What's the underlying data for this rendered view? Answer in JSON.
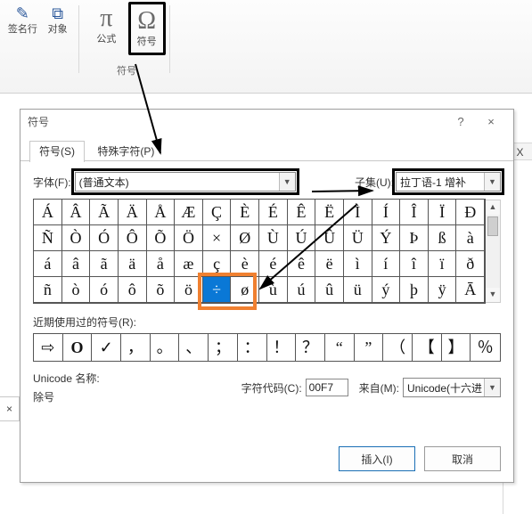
{
  "ribbon": {
    "group1": {
      "sign_line": "签名行",
      "object": "对象",
      "sign_icon": "✎",
      "object_icon": "⧉"
    },
    "group2": {
      "equation": "公式",
      "equation_icon": "π",
      "symbol": "符号",
      "symbol_icon": "Ω",
      "group_label": "符号"
    }
  },
  "sheet": {
    "col_letter": "X"
  },
  "dismiss": {
    "x": "×"
  },
  "dialog": {
    "title": "符号",
    "help_icon": "?",
    "close_icon": "×",
    "tabs": {
      "symbols": "符号(S)",
      "special": "特殊字符(P)"
    },
    "font_label": "字体(F):",
    "font_value": "(普通文本)",
    "subset_label": "子集(U):",
    "subset_value": "拉丁语-1 增补",
    "chargrid": {
      "row1": [
        "Á",
        "Â",
        "Ã",
        "Ä",
        "Å",
        "Æ",
        "Ç",
        "È",
        "É",
        "Ê",
        "Ë",
        "Ì",
        "Í",
        "Î",
        "Ï",
        "Ð"
      ],
      "row2": [
        "Ñ",
        "Ò",
        "Ó",
        "Ô",
        "Õ",
        "Ö",
        "×",
        "Ø",
        "Ù",
        "Ú",
        "Û",
        "Ü",
        "Ý",
        "Þ",
        "ß",
        "à"
      ],
      "row3": [
        "á",
        "â",
        "ã",
        "ä",
        "å",
        "æ",
        "ç",
        "è",
        "é",
        "ê",
        "ë",
        "ì",
        "í",
        "î",
        "ï",
        "ð"
      ],
      "row4": [
        "ñ",
        "ò",
        "ó",
        "ô",
        "õ",
        "ö",
        "÷",
        "ø",
        "ù",
        "ú",
        "û",
        "ü",
        "ý",
        "þ",
        "ÿ",
        "Ā"
      ]
    },
    "recent_label": "近期使用过的符号(R):",
    "recent": [
      "⇨",
      "○",
      "☑",
      "，",
      "。",
      "、",
      "；",
      "：",
      "！",
      "？",
      "“",
      "”",
      "（",
      "【",
      "】",
      "％"
    ],
    "recent_alt": {
      "1": "O",
      "2": "✓"
    },
    "unicode_name_label": "Unicode 名称:",
    "unicode_name_value": "除号",
    "charcode_label": "字符代码(C):",
    "charcode_value": "00F7",
    "from_label": "来自(M):",
    "from_value": "Unicode(十六进",
    "insert_btn": "插入(I)",
    "cancel_btn": "取消"
  }
}
